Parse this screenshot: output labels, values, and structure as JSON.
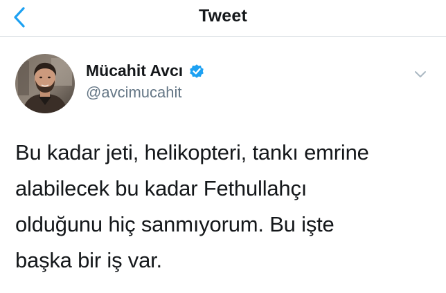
{
  "nav": {
    "title": "Tweet",
    "back_icon": "chevron-left-icon"
  },
  "author": {
    "display_name": "Mücahit Avcı",
    "handle": "@avcimucahit",
    "verified_icon": "verified-badge-icon"
  },
  "menu_icon": "chevron-down-icon",
  "tweet": {
    "lines": [
      "Bu kadar jeti, helikopteri, tankı emrine",
      "alabilecek bu kadar Fethullahçı",
      "olduğunu hiç sanmıyorum. Bu işte",
      "başka bir iş var."
    ]
  },
  "colors": {
    "accent": "#1da1f2",
    "text": "#14171a",
    "secondary_text": "#657786"
  }
}
